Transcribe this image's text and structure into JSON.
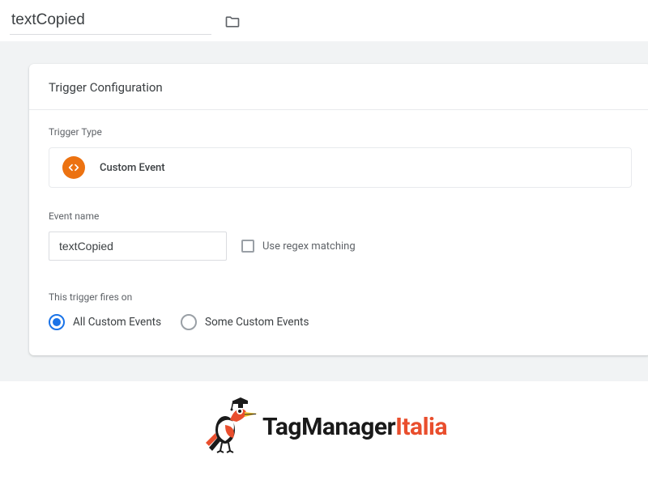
{
  "page": {
    "title_value": "textCopied"
  },
  "card": {
    "header": "Trigger Configuration",
    "trigger_type_label": "Trigger Type",
    "trigger_type": "Custom Event",
    "event_name_label": "Event name",
    "event_name_value": "textCopied",
    "regex_label": "Use regex matching",
    "regex_checked": false,
    "fires_on_label": "This trigger fires on",
    "radios": {
      "all_label": "All Custom Events",
      "some_label": "Some Custom Events",
      "selected": "all"
    }
  },
  "footer": {
    "brand_part1": "TagManager",
    "brand_part2": "Italia"
  }
}
